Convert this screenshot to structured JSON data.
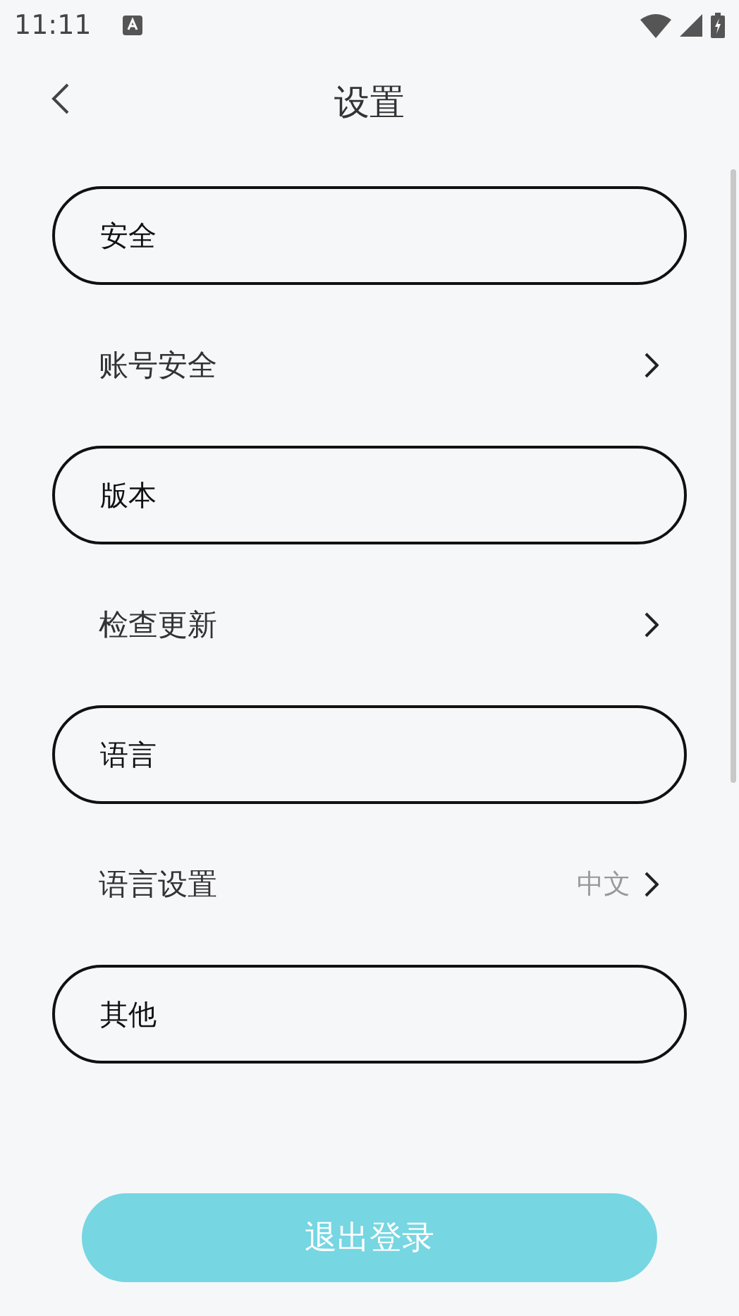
{
  "status_bar": {
    "time": "11:11"
  },
  "header": {
    "title": "设置"
  },
  "sections": [
    {
      "title": "安全",
      "items": [
        {
          "label": "账号安全"
        }
      ]
    },
    {
      "title": "版本",
      "items": [
        {
          "label": "检查更新"
        }
      ]
    },
    {
      "title": "语言",
      "items": [
        {
          "label": "语言设置",
          "value": "中文"
        }
      ]
    },
    {
      "title": "其他"
    }
  ],
  "logout_button": {
    "label": "退出登录"
  }
}
